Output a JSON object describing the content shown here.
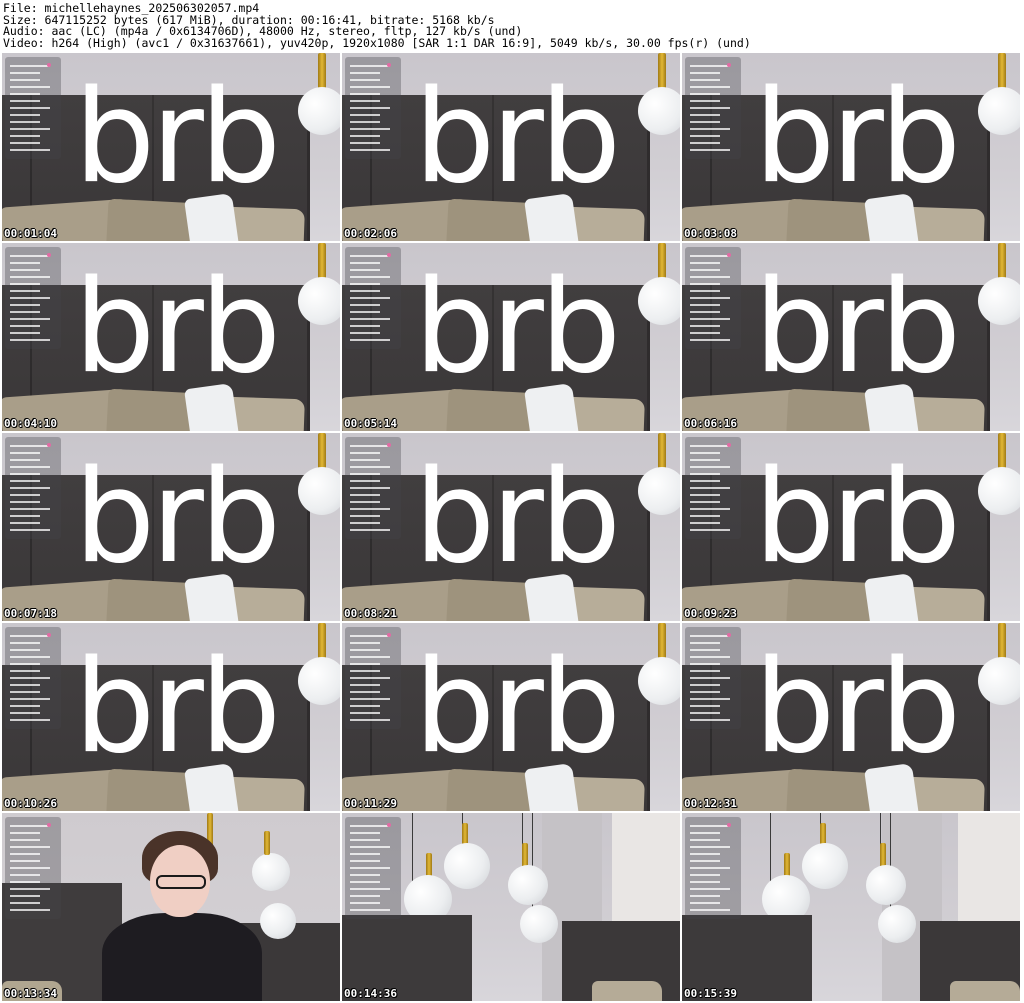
{
  "header": {
    "file": "File: michellehaynes_202506302057.mp4",
    "size": "Size: 647115252 bytes (617 MiB), duration: 00:16:41, bitrate: 5168 kb/s",
    "audio": "Audio: aac (LC) (mp4a / 0x6134706D), 48000 Hz, stereo, fltp, 127 kb/s (und)",
    "video": "Video: h264 (High) (avc1 / 0x31637661), yuv420p, 1920x1080 [SAR 1:1 DAR 16:9], 5049 kb/s, 30.00 fps(r) (und)"
  },
  "overlay_text": "brb",
  "thumbnails": [
    {
      "time": "00:01:04",
      "scene": "brb"
    },
    {
      "time": "00:02:06",
      "scene": "brb"
    },
    {
      "time": "00:03:08",
      "scene": "brb"
    },
    {
      "time": "00:04:10",
      "scene": "brb"
    },
    {
      "time": "00:05:14",
      "scene": "brb"
    },
    {
      "time": "00:06:16",
      "scene": "brb"
    },
    {
      "time": "00:07:18",
      "scene": "brb"
    },
    {
      "time": "00:08:21",
      "scene": "brb"
    },
    {
      "time": "00:09:23",
      "scene": "brb"
    },
    {
      "time": "00:10:26",
      "scene": "brb"
    },
    {
      "time": "00:11:29",
      "scene": "brb"
    },
    {
      "time": "00:12:31",
      "scene": "brb"
    },
    {
      "time": "00:13:34",
      "scene": "person"
    },
    {
      "time": "00:14:36",
      "scene": "lamps"
    },
    {
      "time": "00:15:39",
      "scene": "lamps2"
    }
  ],
  "colors": {
    "timestamp_text": "#ffffff",
    "timestamp_outline": "#000000",
    "headboard": "#3f3c3d",
    "lamp_gold": "#e2b835",
    "overlay_pink": "#e36aa4"
  }
}
